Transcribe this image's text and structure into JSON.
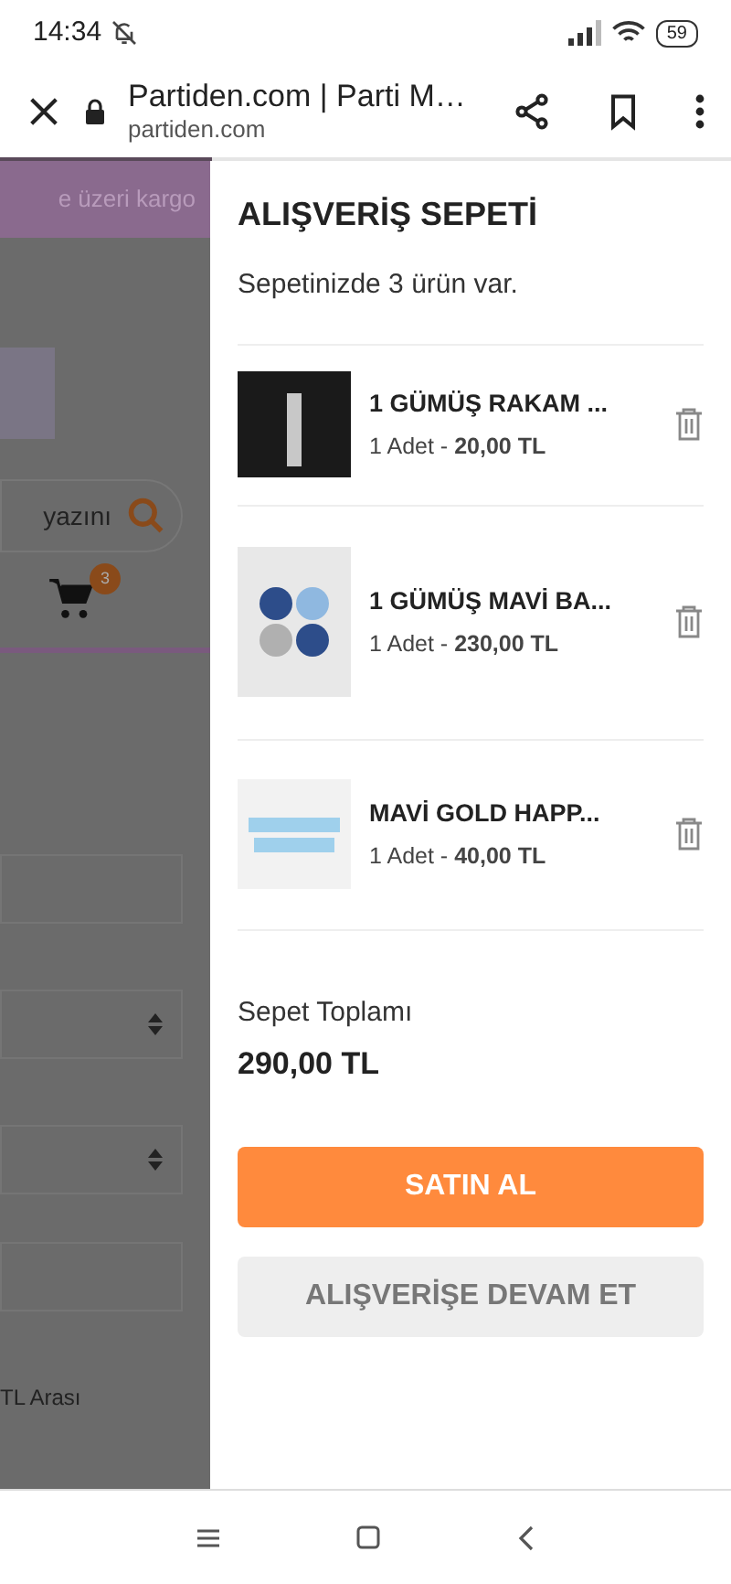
{
  "status_bar": {
    "time": "14:34",
    "battery": "59"
  },
  "browser_bar": {
    "title": "Partiden.com | Parti M…",
    "url": "partiden.com",
    "load_progress": {
      "level": 0.29
    }
  },
  "background_page": {
    "banner": "e üzeri kargo",
    "search": {
      "value": "yazını"
    },
    "cart_badge": "3",
    "footer_text": "TL Arası"
  },
  "cart": {
    "title": "ALIŞVERİŞ SEPETİ",
    "summary": "Sepetinizde 3 ürün var.",
    "items": [
      {
        "name": "1 GÜMÜŞ RAKAM ...",
        "detail": "1 Adet - **20,00 TL**",
        "kind": "candle"
      },
      {
        "name": "1 GÜMÜŞ MAVİ BA...",
        "detail": "1 Adet - **230,00 TL**",
        "kind": "balloons"
      },
      {
        "name": "MAVİ GOLD HAPP...",
        "detail": "1 Adet - **40,00 TL**",
        "kind": "banner"
      }
    ],
    "total_label": "Sepet Toplamı",
    "total": "290,00 TL",
    "buy_button": "SATIN AL",
    "continue_button": "ALIŞVERİŞE DEVAM ET"
  }
}
